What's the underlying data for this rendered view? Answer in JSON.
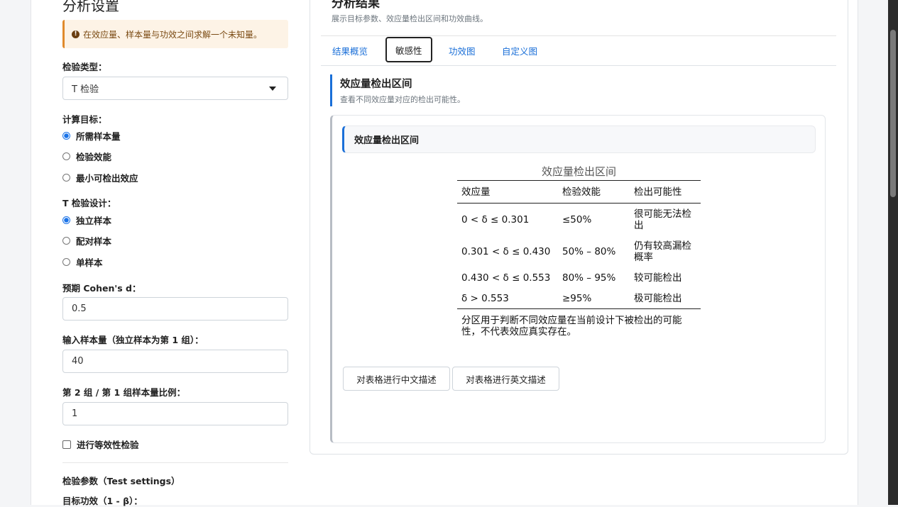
{
  "sidebar": {
    "title": "分析设置",
    "alert_text": "在效应量、样本量与功效之间求解一个未知量。",
    "test_type_label": "检验类型：",
    "test_type_value": "T 检验",
    "target_label": "计算目标：",
    "target_options": [
      "所需样本量",
      "检验效能",
      "最小可检出效应"
    ],
    "design_label": "T 检验设计：",
    "design_options": [
      "独立样本",
      "配对样本",
      "单样本"
    ],
    "cohen_label": "预期 Cohen's d：",
    "cohen_value": "0.5",
    "n_label": "输入样本量（独立样本为第 1 组）：",
    "n_value": "40",
    "ratio_label": "第 2 组 / 第 1 组样本量比例：",
    "ratio_value": "1",
    "equivalence_label": "进行等效性检验",
    "test_settings_label": "检验参数（Test settings）",
    "power_label": "目标功效（1 - β）："
  },
  "main": {
    "title": "分析结果",
    "subtitle": "展示目标参数、效应量检出区间和功效曲线。",
    "tabs": [
      "结果概览",
      "敏感性",
      "功效图",
      "自定义图"
    ],
    "active_tab": "敏感性",
    "section_title": "效应量检出区间",
    "section_subtitle": "查看不同效应量对应的检出可能性。",
    "panel_title": "效应量检出区间",
    "table": {
      "caption": "效应量检出区间",
      "headers": [
        "效应量",
        "检验效能",
        "检出可能性"
      ],
      "rows": [
        [
          "0 < δ ≤ 0.301",
          "≤50%",
          "很可能无法检出"
        ],
        [
          "0.301 < δ ≤ 0.430",
          "50% – 80%",
          "仍有较高漏检概率"
        ],
        [
          "0.430 < δ ≤ 0.553",
          "80% – 95%",
          "较可能检出"
        ],
        [
          "δ > 0.553",
          "≥95%",
          "极可能检出"
        ]
      ],
      "note": "分区用于判断不同效应量在当前设计下被检出的可能性，不代表效应真实存在。"
    },
    "buttons": [
      "对表格进行中文描述",
      "对表格进行英文描述"
    ]
  }
}
